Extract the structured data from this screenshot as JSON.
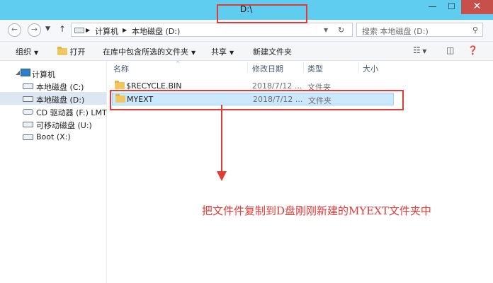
{
  "window": {
    "title": "D:\\",
    "buttons": {
      "minimize": "—",
      "maximize": "☐",
      "close": "✕"
    }
  },
  "nav": {
    "back_icon": "arrow-left-icon",
    "forward_icon": "arrow-right-icon",
    "recent_icon": "chevron-down-icon",
    "up_icon": "arrow-up-icon",
    "breadcrumb": [
      "计算机",
      "本地磁盘 (D:)"
    ],
    "search_placeholder": "搜索 本地磁盘 (D:)"
  },
  "toolbar": {
    "organize": "组织",
    "open": "打开",
    "include_in_library": "在库中包含所选的文件夹",
    "share": "共享",
    "new_folder": "新建文件夹"
  },
  "sidebar": {
    "items": [
      {
        "label": "计算机",
        "icon": "computer-icon"
      },
      {
        "label": "本地磁盘 (C:)",
        "icon": "drive-icon"
      },
      {
        "label": "本地磁盘 (D:)",
        "icon": "drive-icon",
        "selected": true
      },
      {
        "label": "CD 驱动器 (F:) LMT",
        "icon": "cd-drive-icon"
      },
      {
        "label": "可移动磁盘 (U:)",
        "icon": "removable-drive-icon"
      },
      {
        "label": "Boot (X:)",
        "icon": "drive-icon"
      }
    ]
  },
  "file_list": {
    "columns": [
      "名称",
      "修改日期",
      "类型",
      "大小"
    ],
    "rows": [
      {
        "name": "$RECYCLE.BIN",
        "date": "2018/7/12 ...",
        "type": "文件夹",
        "size": ""
      },
      {
        "name": "MYEXT",
        "date": "2018/7/12 ...",
        "type": "文件夹",
        "size": "",
        "selected": true
      }
    ]
  },
  "annotation": {
    "text": "把文件件复制到D盘刚刚新建的MYEXT文件夹中",
    "color": "#e53935"
  },
  "colors": {
    "titlebar": "#5fcdf0",
    "close_button": "#c7504a",
    "selection": "#cce8ff",
    "highlight_red": "#e53935"
  }
}
